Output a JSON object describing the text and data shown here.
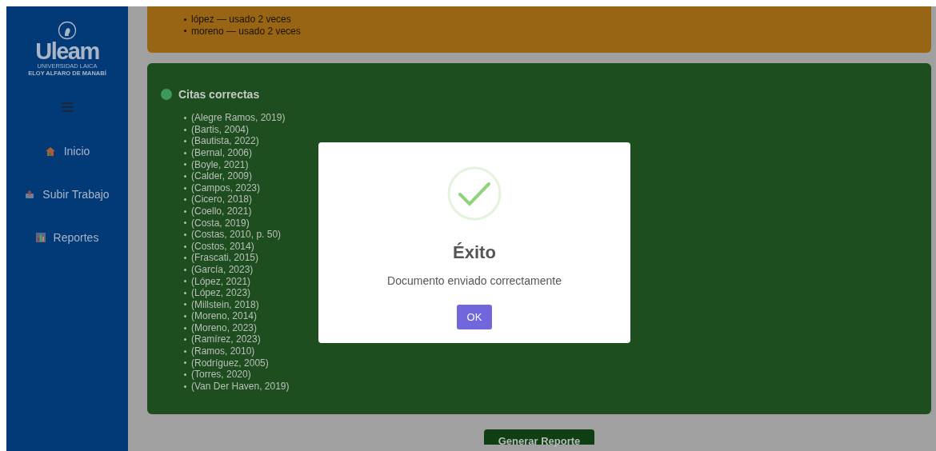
{
  "sidebar": {
    "logo": {
      "name": "Uleam",
      "line_1": "UNIVERSIDAD LAICA",
      "line_2": "ELOY ALFARO DE MANABÍ"
    },
    "items": [
      {
        "label": "Inicio",
        "kind": "home",
        "selected": false
      },
      {
        "label": "Subir Trabajo",
        "kind": "upload",
        "selected": false
      },
      {
        "label": "Reportes",
        "kind": "chart",
        "selected": false
      }
    ]
  },
  "warnings": {
    "items": [
      "lópez — usado 2 veces",
      "moreno — usado 2 veces"
    ]
  },
  "correct": {
    "title": "Citas correctas",
    "items": [
      "(Alegre Ramos, 2019)",
      "(Bartis, 2004)",
      "(Bautista, 2022)",
      "(Bernal, 2006)",
      "(Boyle, 2021)",
      "(Calder, 2009)",
      "(Campos, 2023)",
      "(Cicero, 2018)",
      "(Coello, 2021)",
      "(Costa, 2019)",
      "(Costas, 2010, p. 50)",
      "(Costos, 2014)",
      "(Frascati, 2015)",
      "(García, 2023)",
      "(López, 2021)",
      "(López, 2023)",
      "(Millstein, 2018)",
      "(Moreno, 2014)",
      "(Moreno, 2023)",
      "(Ramírez, 2023)",
      "(Ramos, 2010)",
      "(Rodríguez, 2005)",
      "(Torres, 2020)",
      "(Van Der Haven, 2019)"
    ]
  },
  "report_button": "Generar Reporte",
  "dialog": {
    "kind": "success",
    "title": "Éxito",
    "message": "Documento enviado correctamente",
    "button": "OK"
  }
}
